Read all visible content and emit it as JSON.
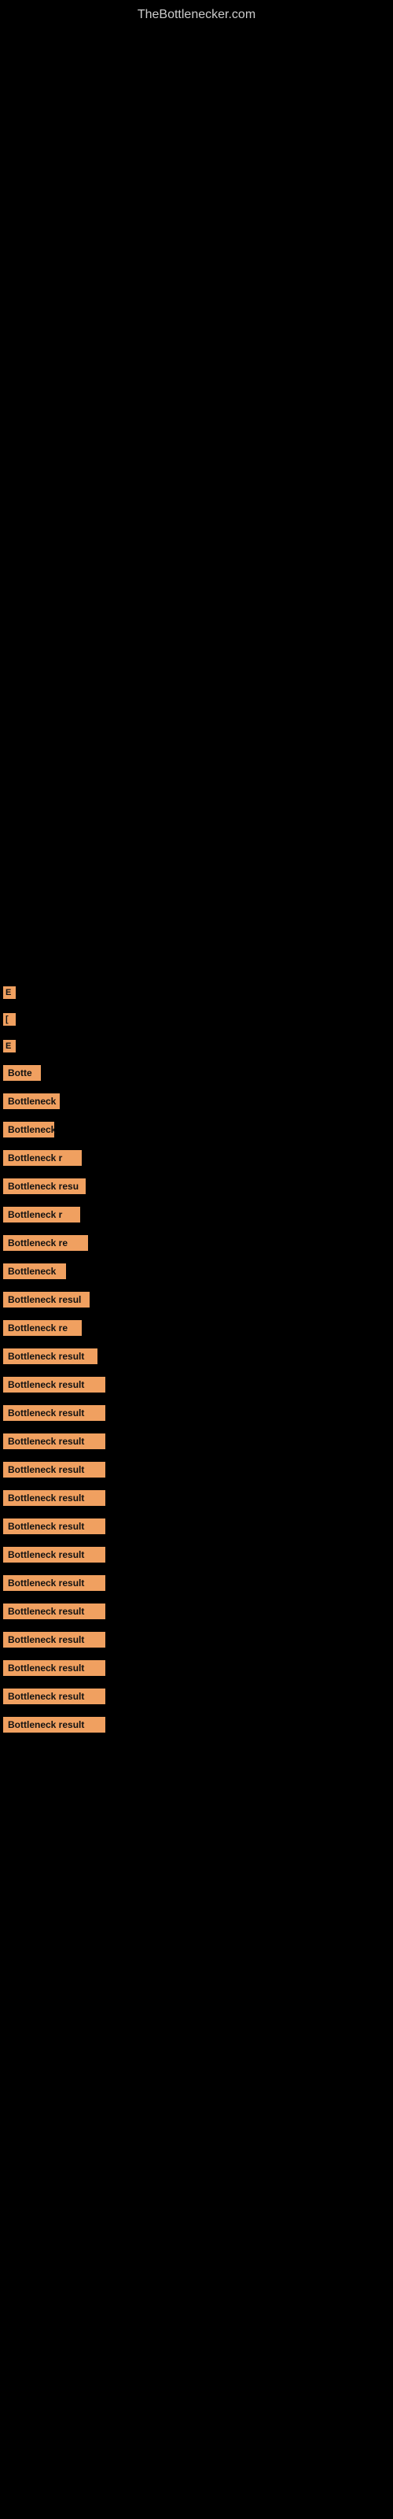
{
  "site": {
    "title": "TheBottlenecker.com"
  },
  "labels": {
    "e1": "E",
    "e2": "[",
    "e3": "E",
    "b1": "Botte",
    "b2": "Bottleneck",
    "b3": "Bottleneck",
    "b4": "Bottleneck r",
    "b5": "Bottleneck resu",
    "b6": "Bottleneck r",
    "b7": "Bottleneck re",
    "b8": "Bottleneck",
    "b9": "Bottleneck resul",
    "b10": "Bottleneck re",
    "b11": "Bottleneck result",
    "b12": "Bottleneck result",
    "b13": "Bottleneck result",
    "b14": "Bottleneck result",
    "b15": "Bottleneck result",
    "b16": "Bottleneck result",
    "b17": "Bottleneck result",
    "b18": "Bottleneck result",
    "b19": "Bottleneck result",
    "b20": "Bottleneck result",
    "b21": "Bottleneck result",
    "b22": "Bottleneck result",
    "b23": "Bottleneck result",
    "b24": "Bottleneck result"
  }
}
